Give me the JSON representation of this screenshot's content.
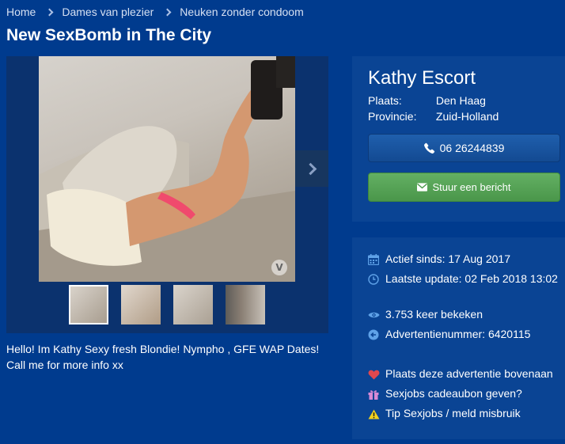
{
  "breadcrumb": {
    "items": [
      "Home",
      "Dames van plezier",
      "Neuken zonder condoom"
    ]
  },
  "title": "New SexBomb in The City",
  "gallery": {
    "watermark": "V",
    "thumbnail_count": 4,
    "active_thumbnail": 1
  },
  "description": "Hello! Im Kathy Sexy fresh Blondie! Nympho , GFE WAP Dates! Call me for more info xx",
  "profile": {
    "name": "Kathy Escort",
    "place_label": "Plaats:",
    "place_value": "Den Haag",
    "province_label": "Provincie:",
    "province_value": "Zuid-Holland",
    "phone": "06 26244839",
    "message_label": "Stuur een bericht"
  },
  "stats": {
    "active_since": "Actief sinds: 17 Aug 2017",
    "last_update": "Laatste update: 02 Feb 2018 13:02",
    "views": "3.753 keer bekeken",
    "ad_number": "Advertentienummer: 6420115"
  },
  "actions": {
    "promote": "Plaats deze advertentie bovenaan",
    "gift": "Sexjobs cadeaubon geven?",
    "report": "Tip Sexjobs / meld misbruik"
  },
  "colors": {
    "background": "#003b8e",
    "card": "#0a4494",
    "phone_button": "#1f5fad",
    "message_button": "#5aa65a",
    "heart": "#e0484f",
    "warning": "#f2d21e"
  },
  "icons": [
    "chevron-right-icon",
    "phone-icon",
    "envelope-icon",
    "calendar-icon",
    "clock-icon",
    "eye-icon",
    "arrow-circle-icon",
    "heart-icon",
    "gift-icon",
    "warning-icon"
  ]
}
